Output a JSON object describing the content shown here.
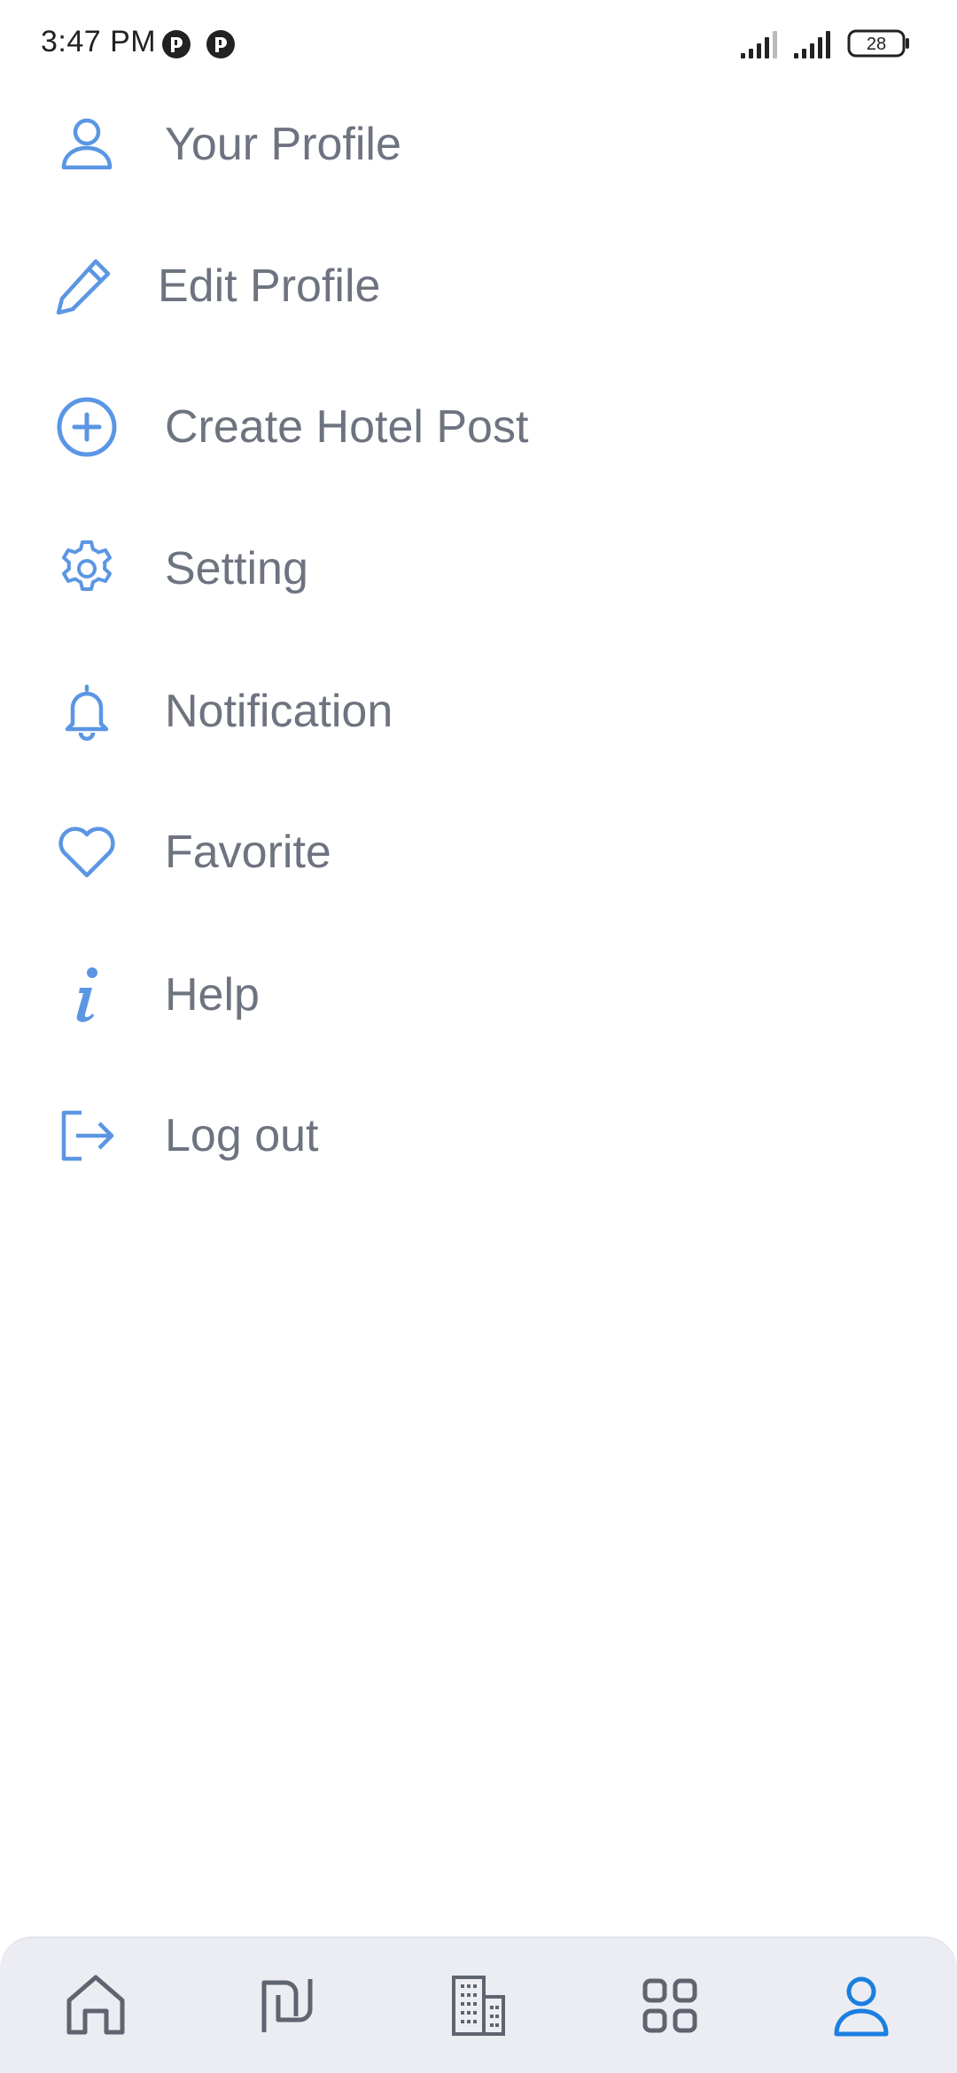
{
  "status_bar": {
    "time": "3:47 PM",
    "battery": "28"
  },
  "theme": {
    "accent": "#5b96e4",
    "label_color": "#6e7380",
    "nav_icon_color": "#5f6470",
    "nav_active_color": "#1a7fe0",
    "nav_bg": "#ecedf2"
  },
  "menu": {
    "items": [
      {
        "label": "Your Profile",
        "icon": "user-icon"
      },
      {
        "label": "Edit Profile",
        "icon": "pencil-icon"
      },
      {
        "label": "Create Hotel Post",
        "icon": "plus-circle-icon"
      },
      {
        "label": "Setting",
        "icon": "gear-icon"
      },
      {
        "label": "Notification",
        "icon": "bell-icon"
      },
      {
        "label": "Favorite",
        "icon": "heart-icon"
      },
      {
        "label": "Help",
        "icon": "info-icon"
      },
      {
        "label": "Log out",
        "icon": "logout-icon"
      }
    ]
  },
  "bottom_nav": {
    "items": [
      {
        "icon": "home-icon",
        "active": false
      },
      {
        "icon": "shekel-icon",
        "active": false
      },
      {
        "icon": "building-icon",
        "active": false
      },
      {
        "icon": "grid-icon",
        "active": false
      },
      {
        "icon": "user-icon",
        "active": true
      }
    ]
  }
}
